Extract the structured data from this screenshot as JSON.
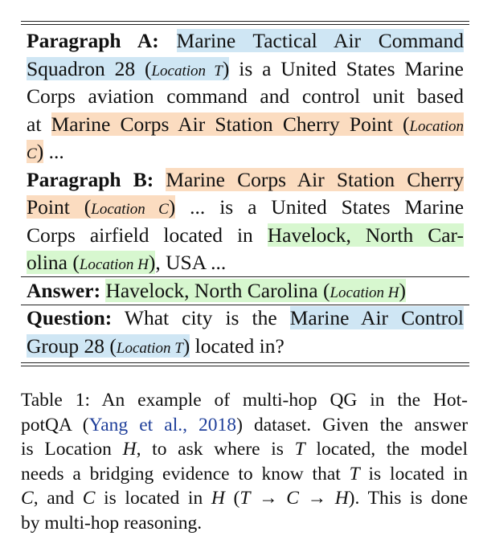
{
  "table": {
    "paragraph_a": {
      "label": "Paragraph A:",
      "ent1_part1": "Marine Tactical Air Command",
      "ent1_part2": "Squadron 28 (",
      "loc_t": "Location T",
      "close": ")",
      "text1": "is a United States Marine",
      "text2": "Corps aviation command and control unit based",
      "at": "at",
      "ent2": "Marine Corps Air Station Cherry Point (",
      "loc_c_part1": "Location",
      "loc_c_part2": "C",
      "ellipsis": "..."
    },
    "paragraph_b": {
      "label": "Paragraph B:",
      "ent1_part1": "Marine Corps Air Station Cherry",
      "ent1_part2": "Point (",
      "loc_c": "Location C",
      "close": ")",
      "ellipsis": "...",
      "text1": "is a United States Marine",
      "text2": "Corps airfield located in",
      "ent2_part1": "Havelock, North Car-",
      "ent2_part2": "olina (",
      "loc_h": "Location H",
      "close2": ")",
      "text3": ", USA ..."
    },
    "answer": {
      "label": "Answer:",
      "value": "Havelock, North Carolina (",
      "loc_h": "Location H",
      "close": ")"
    },
    "question": {
      "label": "Question:",
      "text1": "What city is the",
      "ent1_part1": "Marine Air Control",
      "ent1_part2": "Group 28 (",
      "loc_t": "Location T",
      "close": ")",
      "text2": "located in?"
    }
  },
  "caption": {
    "line1": "Table 1:  An example of multi-hop QG in the Hot-",
    "line2_a": "potQA (",
    "cite": "Yang et al., 2018",
    "line2_b": ") dataset.  Given the answer",
    "line3_a": "is Location ",
    "H": "H",
    "line3_b": ", to ask where is ",
    "T": "T",
    "line3_c": " located, the model",
    "line4_a": "needs a bridging evidence to know that ",
    "line4_b": " is located in",
    "C": "C",
    "line5_a": ", and ",
    "line5_b": " is located in ",
    "line5_c": " (",
    "arrow": " → ",
    "line5_d": "). This is done",
    "line6": "by multi-hop reasoning."
  },
  "colors": {
    "location_t_highlight": "#cfe6f4",
    "location_c_highlight": "#fbdcc0",
    "location_h_highlight": "#d7f7cf",
    "citation": "#1f3f9a"
  }
}
